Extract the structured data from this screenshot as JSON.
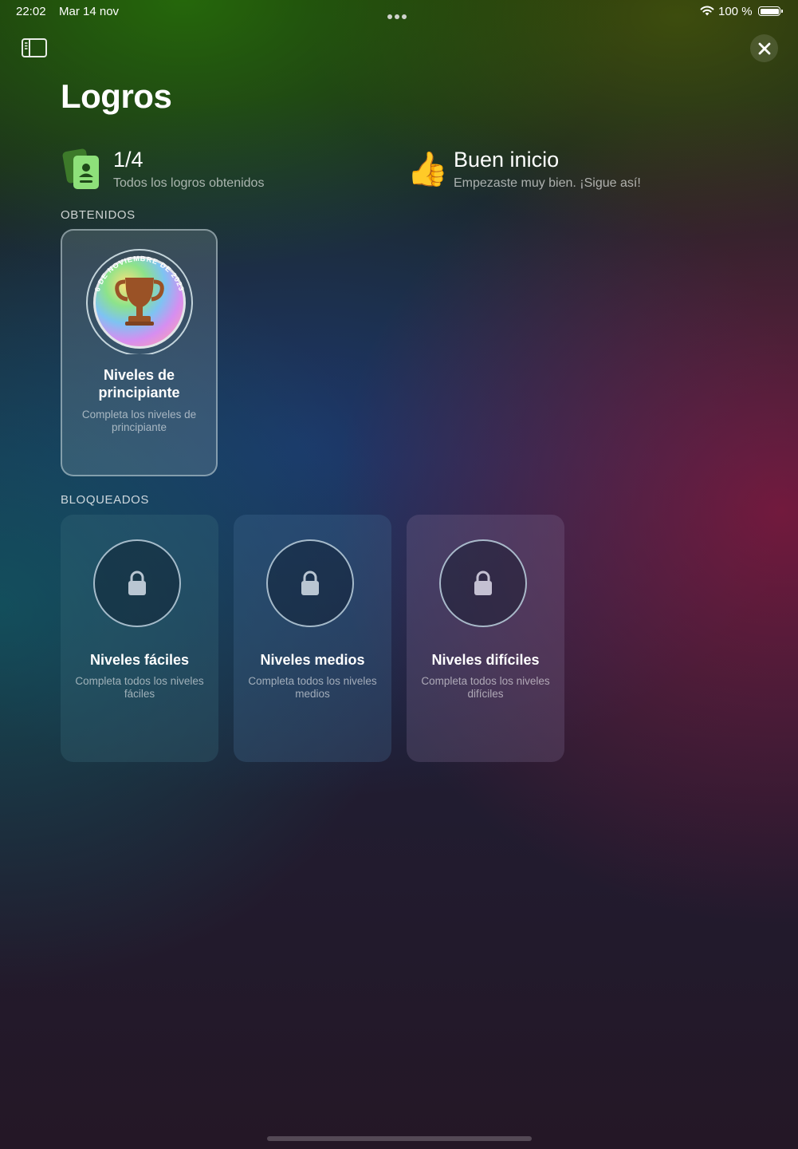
{
  "status_bar": {
    "time": "22:02",
    "date": "Mar 14 nov",
    "battery_percent": "100 %",
    "battery_level": 1.0
  },
  "header": {
    "title": "Logros",
    "sidebar_icon": "sidebar-icon",
    "close_icon": "close-icon"
  },
  "stats": [
    {
      "value": "1/4",
      "caption": "Todos los logros obtenidos",
      "icon": "achievement-cards-icon"
    },
    {
      "value": "Buen inicio",
      "caption": "Empezaste muy bien. ¡Sigue así!",
      "icon": "👍"
    }
  ],
  "earned": {
    "label": "OBTENIDOS",
    "items": [
      {
        "name": "Niveles de principiante",
        "description": "Completa los niveles de principiante",
        "date": "6 DE NOVIEMBRE DE 2023",
        "icon": "trophy-icon"
      }
    ]
  },
  "locked": {
    "label": "BLOQUEADOS",
    "items": [
      {
        "name": "Niveles fáciles",
        "description": "Completa todos los niveles fáciles",
        "icon": "lock-icon"
      },
      {
        "name": "Niveles medios",
        "description": "Completa todos los niveles medios",
        "icon": "lock-icon"
      },
      {
        "name": "Niveles difíciles",
        "description": "Completa todos los niveles difíciles",
        "icon": "lock-icon"
      }
    ]
  },
  "colors": {
    "accent_green": "#8ee07a",
    "trophy_bronze": "#9a5226"
  }
}
